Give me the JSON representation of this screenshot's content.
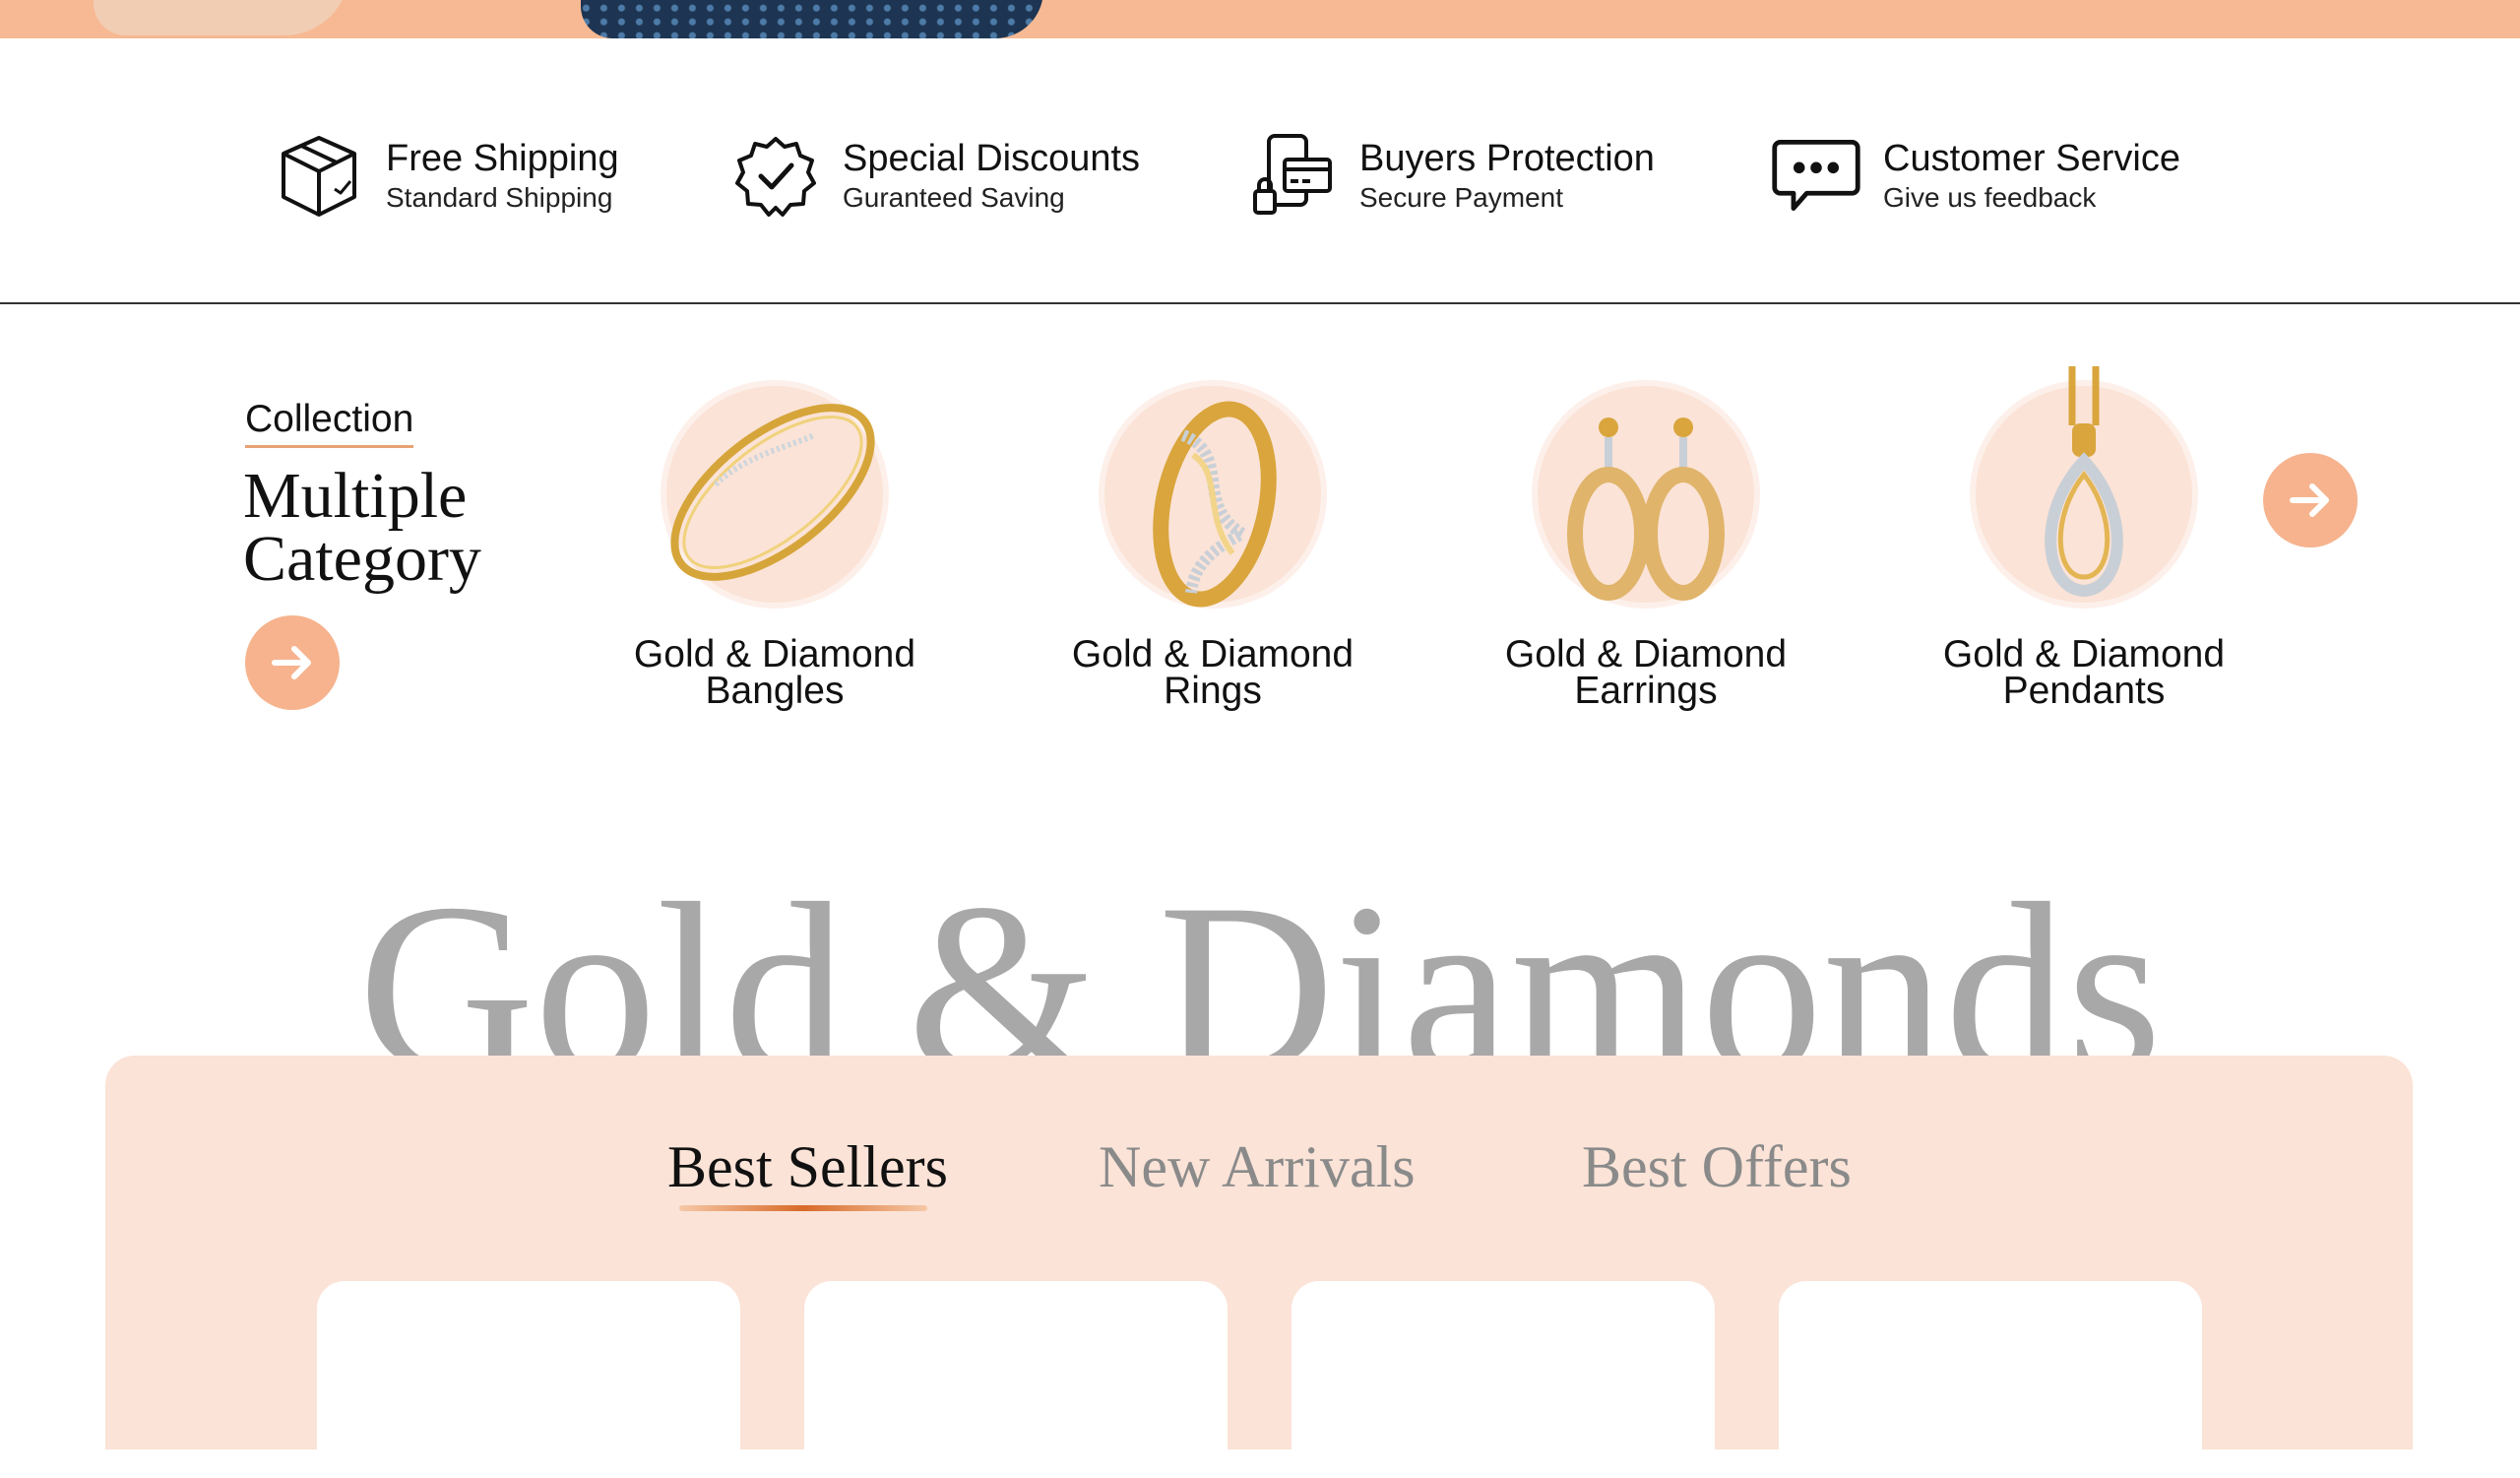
{
  "features": [
    {
      "icon": "box-icon",
      "title": "Free Shipping",
      "subtitle": "Standard Shipping"
    },
    {
      "icon": "verified-badge-icon",
      "title": "Special Discounts",
      "subtitle": "Guranteed Saving"
    },
    {
      "icon": "secure-payment-icon",
      "title": "Buyers Protection",
      "subtitle": "Secure Payment"
    },
    {
      "icon": "chat-bubble-icon",
      "title": "Customer Service",
      "subtitle": "Give us feedback"
    }
  ],
  "collection": {
    "label": "Collection",
    "title_line1": "Multiple",
    "title_line2": "Category"
  },
  "categories": [
    {
      "line1": "Gold & Diamond",
      "line2": "Bangles",
      "icon": "bangle-icon"
    },
    {
      "line1": "Gold & Diamond",
      "line2": "Rings",
      "icon": "ring-icon"
    },
    {
      "line1": "Gold & Diamond",
      "line2": "Earrings",
      "icon": "earrings-icon"
    },
    {
      "line1": "Gold & Diamond",
      "line2": "Pendants",
      "icon": "pendant-icon"
    }
  ],
  "banner_text": "Gold & Diamonds",
  "tabs": [
    "Best Sellers",
    "New Arrivals",
    "Best Offers"
  ],
  "active_tab": "Best Sellers",
  "colors": {
    "accent": "#f6b38e",
    "panel": "#fbe3d7",
    "hero": "#f7b993"
  }
}
